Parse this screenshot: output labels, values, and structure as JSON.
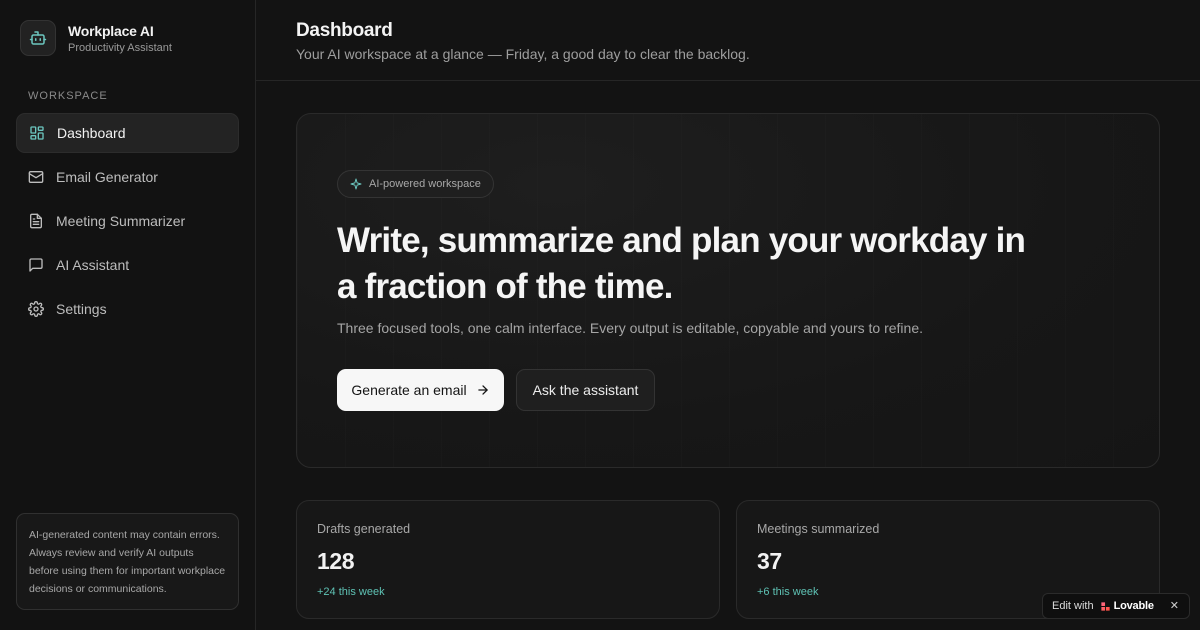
{
  "brand": {
    "title": "Workplace AI",
    "subtitle": "Productivity Assistant",
    "icon": "robot-icon"
  },
  "sidebar": {
    "section_label": "WORKSPACE",
    "items": [
      {
        "label": "Dashboard",
        "icon": "dashboard-icon",
        "active": true
      },
      {
        "label": "Email Generator",
        "icon": "mail-icon",
        "active": false
      },
      {
        "label": "Meeting Summarizer",
        "icon": "document-icon",
        "active": false
      },
      {
        "label": "AI Assistant",
        "icon": "chat-icon",
        "active": false
      },
      {
        "label": "Settings",
        "icon": "gear-icon",
        "active": false
      }
    ],
    "disclaimer": "AI-generated content may contain errors. Always review and verify AI outputs before using them for important workplace decisions or communications."
  },
  "header": {
    "title": "Dashboard",
    "subtitle": "Your AI workspace at a glance — Friday, a good day to clear the backlog."
  },
  "hero": {
    "pill": "AI-powered workspace",
    "title": "Write, summarize and plan your workday in a fraction of the time.",
    "subtitle": "Three focused tools, one calm interface. Every output is editable, copyable and yours to refine.",
    "primary_button": "Generate an email",
    "secondary_button": "Ask the assistant"
  },
  "stats": [
    {
      "label": "Drafts generated",
      "value": "128",
      "delta": "+24 this week"
    },
    {
      "label": "Meetings summarized",
      "value": "37",
      "delta": "+6 this week"
    }
  ],
  "badge": {
    "prefix": "Edit with",
    "brand": "Lovable",
    "close": "✕"
  },
  "colors": {
    "accent": "#5fc3b5",
    "background": "#131313",
    "icon_accent": "#6cc7c0"
  }
}
